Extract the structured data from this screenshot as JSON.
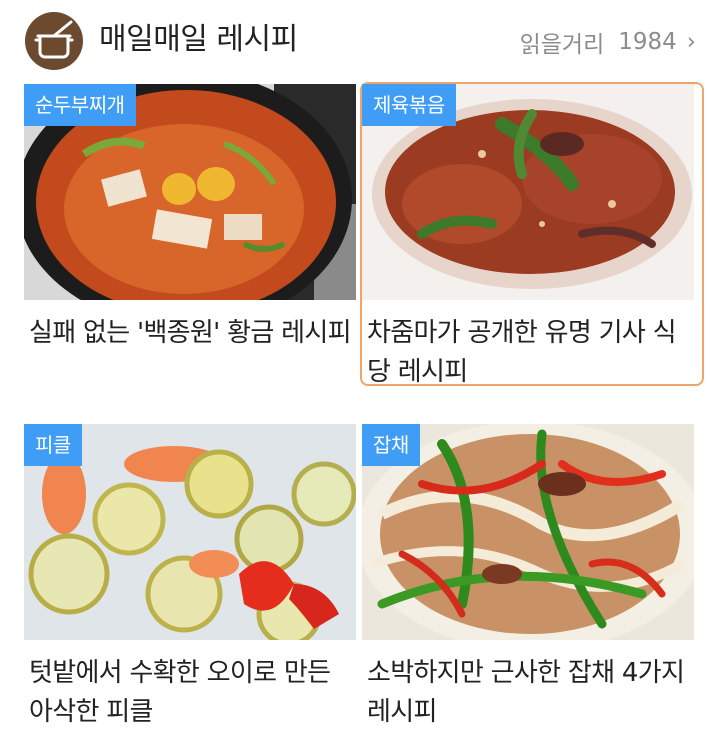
{
  "header": {
    "title": "매일매일 레시피",
    "more_label": "읽을거리",
    "more_count": "1984",
    "more_arrow": "›"
  },
  "cards": [
    {
      "tag": "순두부찌개",
      "caption": "실패 없는 '백종원' 황금 레시피"
    },
    {
      "tag": "제육볶음",
      "caption": "차줌마가 공개한 유명 기사 식당 레시피"
    },
    {
      "tag": "피클",
      "caption": "텃밭에서 수확한 오이로 만든 아삭한 피클"
    },
    {
      "tag": "잡채",
      "caption": "소박하지만 근사한 잡채 4가지 레시피"
    }
  ],
  "colors": {
    "tag_bg": "#3f9df5",
    "selected_outline": "#f0a469",
    "logo_bg": "#6b4a30"
  },
  "icons": {
    "logo": "cooking-pot-icon",
    "more": "chevron-right-icon"
  }
}
